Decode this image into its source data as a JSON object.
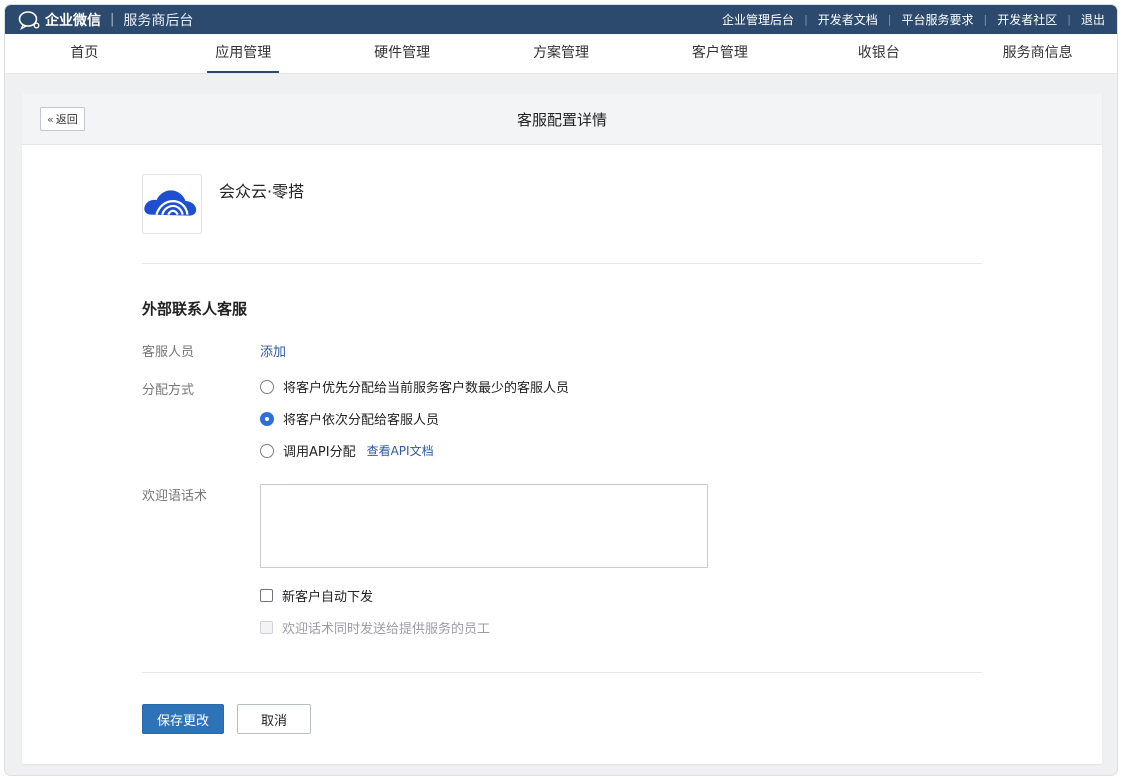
{
  "topbar": {
    "brand_name": "企业微信",
    "separator": "|",
    "brand_sub": "服务商后台",
    "links": [
      "企业管理后台",
      "开发者文档",
      "平台服务要求",
      "开发者社区",
      "退出"
    ]
  },
  "nav": {
    "items": [
      "首页",
      "应用管理",
      "硬件管理",
      "方案管理",
      "客户管理",
      "收银台",
      "服务商信息"
    ],
    "active": "应用管理"
  },
  "card": {
    "back_label": "返回",
    "title": "客服配置详情"
  },
  "app": {
    "name": "会众云·零搭",
    "logo_icon": "blue-cloud-logo-icon"
  },
  "section": {
    "title": "外部联系人客服",
    "agents_label": "客服人员",
    "add_link": "添加",
    "distribution_label": "分配方式",
    "distribution_options": [
      {
        "label": "将客户优先分配给当前服务客户数最少的客服人员",
        "checked": false
      },
      {
        "label": "将客户依次分配给客服人员",
        "checked": true
      },
      {
        "label": "调用API分配",
        "checked": false
      }
    ],
    "api_doc_link": "查看API文档",
    "welcome_label": "欢迎语话术",
    "welcome_value": "",
    "auto_send_label": "新客户自动下发",
    "auto_send_checked": false,
    "send_to_staff_label": "欢迎话术同时发送给提供服务的员工",
    "send_to_staff_disabled": true
  },
  "actions": {
    "save_label": "保存更改",
    "cancel_label": "取消"
  },
  "colors": {
    "topbar_bg": "#2c4a6e",
    "primary_button": "#2e73b8",
    "link": "#2c5aa0",
    "radio_checked": "#2f6fd8"
  }
}
